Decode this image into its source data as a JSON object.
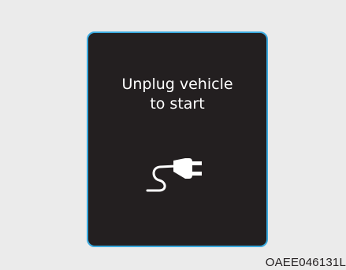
{
  "display": {
    "message_line1": "Unplug vehicle",
    "message_line2": "to start",
    "icon": "plug-cable-icon",
    "border_color": "#3aa9de",
    "background_color": "#231f20",
    "text_color": "#ffffff"
  },
  "figure": {
    "code": "OAEE046131L"
  }
}
